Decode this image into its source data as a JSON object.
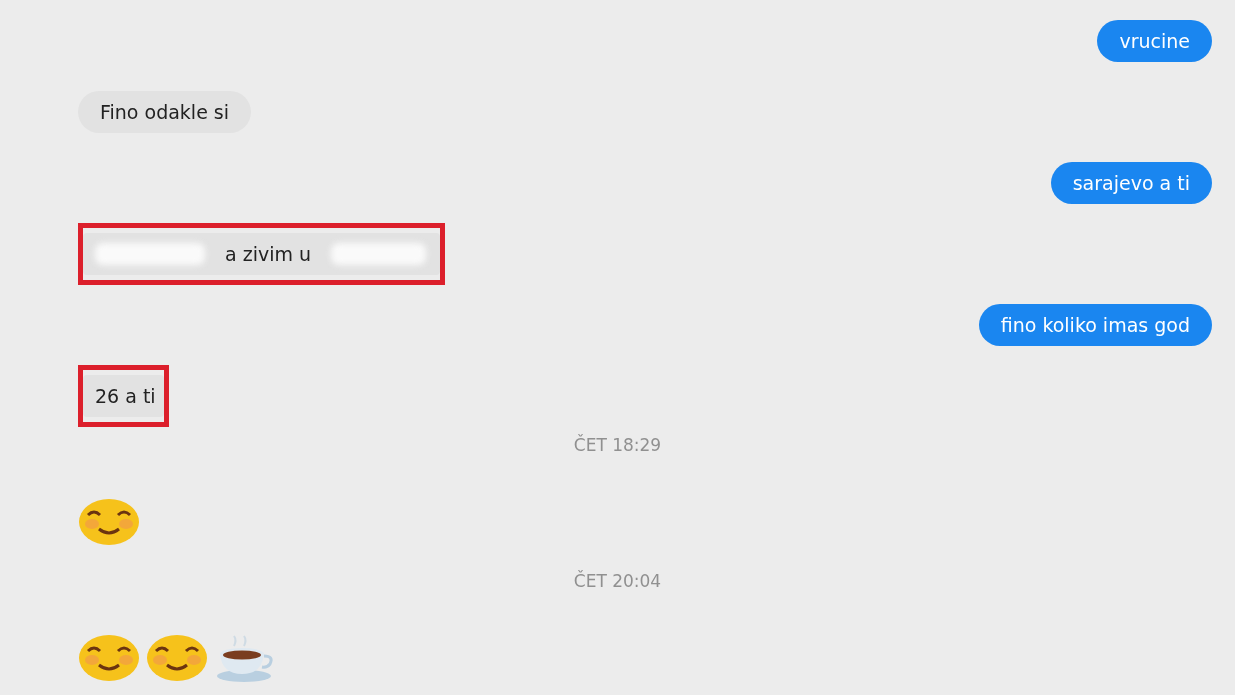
{
  "messages": [
    {
      "kind": "sent",
      "text": "vrucine",
      "highlighted": false
    },
    {
      "kind": "received",
      "text": "Fino odakle si",
      "highlighted": false
    },
    {
      "kind": "sent",
      "text": "sarajevo a ti",
      "highlighted": false
    },
    {
      "kind": "received",
      "text": "a zivim u",
      "highlighted": true,
      "redacted_before": true,
      "redacted_after": true
    },
    {
      "kind": "sent",
      "text": "fino koliko imas god",
      "highlighted": false
    },
    {
      "kind": "received",
      "text": "26 a ti",
      "highlighted": true
    },
    {
      "kind": "time",
      "text": "ČET 18:29"
    },
    {
      "kind": "emoji",
      "emoji": [
        {
          "kind": "smile"
        }
      ]
    },
    {
      "kind": "time",
      "text": "ČET 20:04"
    },
    {
      "kind": "emoji",
      "emoji": [
        {
          "kind": "smile"
        },
        {
          "kind": "smile"
        },
        {
          "kind": "coffee"
        }
      ]
    }
  ]
}
